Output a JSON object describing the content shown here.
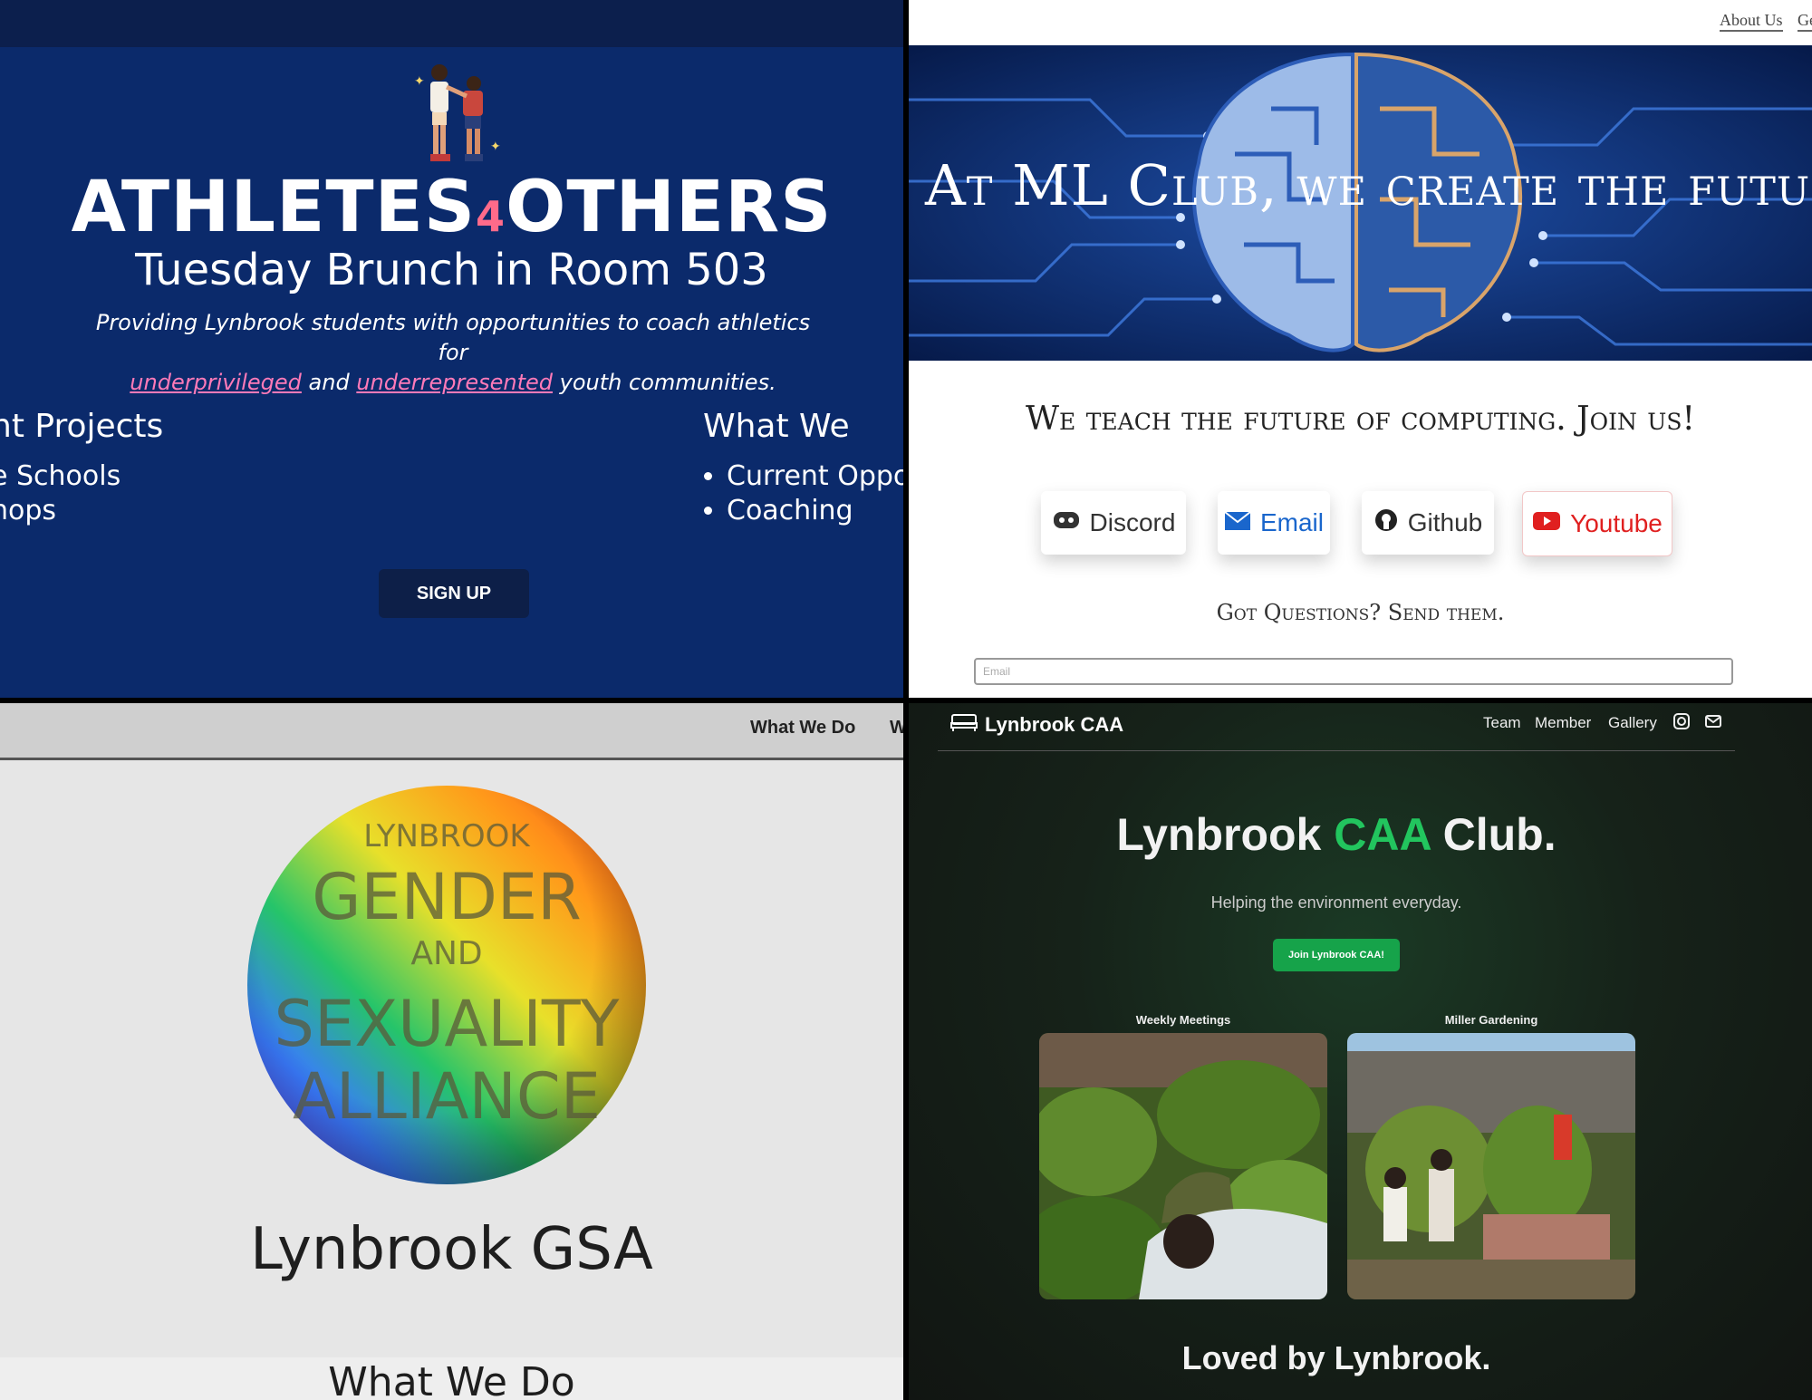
{
  "athletes": {
    "brand_part1": "ATHLETES",
    "brand_part2": "4",
    "brand_part3": "OTHERS",
    "subtitle": "Tuesday Brunch in Room 503",
    "mission_1": "Providing Lynbrook students with opportunities to coach athletics for",
    "mission_pink1": "underprivileged",
    "mission_and": "and",
    "mission_pink2": "underrepresented",
    "mission_2": "youth communities.",
    "left_heading": "nt Projects",
    "left_items": [
      "e Schools",
      "hops"
    ],
    "right_heading": "What We",
    "right_items": [
      "Current Oppo",
      "Coaching"
    ],
    "signup": "SIGN UP"
  },
  "mlclub": {
    "nav_about": "About Us",
    "nav_cut": "Ge",
    "hero": "At ML Club, we create the future.",
    "teach": "We teach the future of computing. Join us!",
    "buttons": {
      "discord": "Discord",
      "email": "Email",
      "github": "Github",
      "youtube": "Youtube"
    },
    "questions": "Got Questions? Send them.",
    "email_placeholder": "Email"
  },
  "gsa": {
    "nav_what": "What We Do",
    "nav_cut": "W",
    "logo_lynbrook": "LYNBROOK",
    "logo_gender": "GENDER",
    "logo_and": "AND",
    "logo_sexuality": "SEXUALITY",
    "logo_alliance": "ALLIANCE",
    "name": "Lynbrook GSA",
    "what_we_do": "What We Do"
  },
  "caa": {
    "brand": "Lynbrook CAA",
    "nav_team": "Team",
    "nav_member": "Member",
    "nav_gallery": "Gallery",
    "title_1": "Lynbrook ",
    "title_green": "CAA",
    "title_2": " Club.",
    "tagline": "Helping the environment everyday.",
    "join": "Join Lynbrook CAA!",
    "caption_1": "Weekly Meetings",
    "caption_2": "Miller Gardening",
    "loved": "Loved by Lynbrook."
  }
}
